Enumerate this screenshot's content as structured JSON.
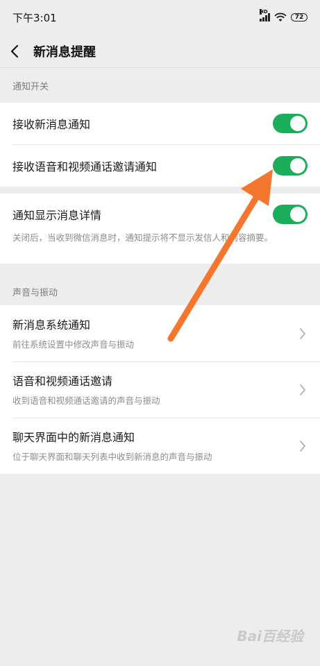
{
  "status": {
    "time": "下午3:01",
    "network": "HD",
    "battery": "72"
  },
  "header": {
    "title": "新消息提醒"
  },
  "sections": {
    "notify": {
      "label": "通知开关",
      "items": [
        {
          "label": "接收新消息通知",
          "on": true
        },
        {
          "label": "接收语音和视频通话邀请通知",
          "on": true
        }
      ],
      "detail": {
        "label": "通知显示消息详情",
        "on": true,
        "desc": "关闭后，当收到微信消息时，通知提示将不显示发信人和内容摘要。"
      }
    },
    "sound": {
      "label": "声音与振动",
      "items": [
        {
          "label": "新消息系统通知",
          "desc": "前往系统设置中修改声音与振动"
        },
        {
          "label": "语音和视频通话邀请",
          "desc": "收到语音和视频通话邀请的声音与振动"
        },
        {
          "label": "聊天界面中的新消息通知",
          "desc": "位于聊天界面和聊天列表中收到新消息的声音与振动"
        }
      ]
    }
  },
  "colors": {
    "toggle_on": "#1aad5a",
    "arrow": "#f5772e"
  },
  "watermark": "Bai百经验"
}
